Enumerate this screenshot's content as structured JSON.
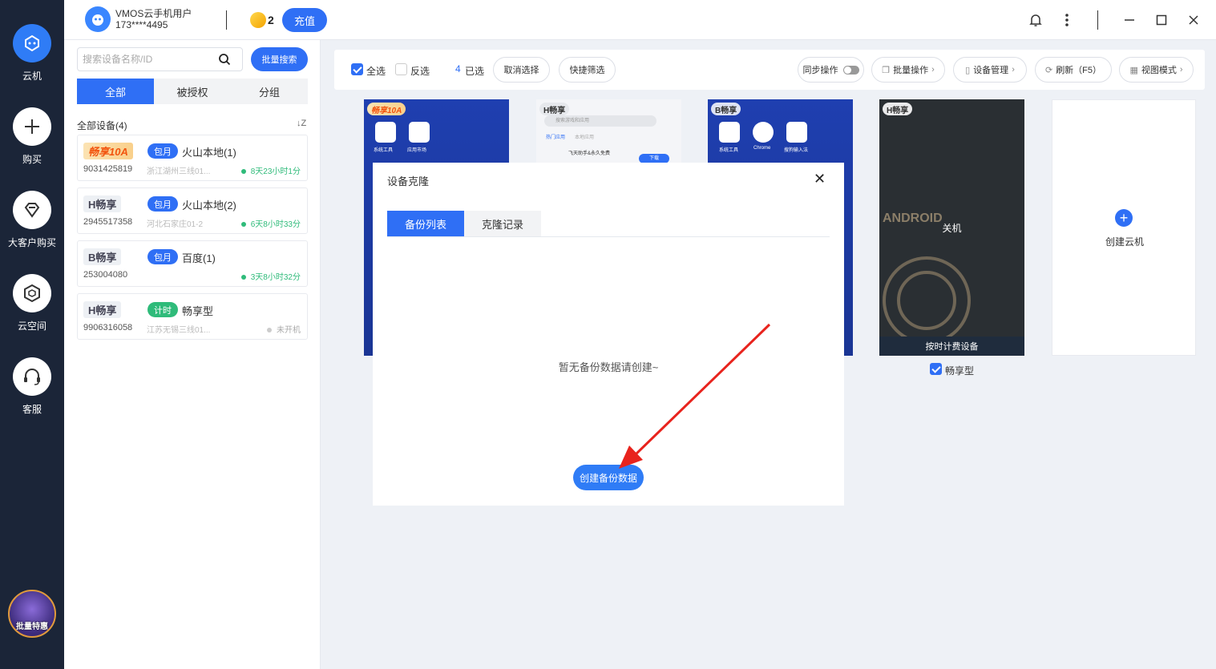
{
  "sidebar": {
    "items": [
      {
        "label": "云机",
        "icon": "cloud-phone-icon",
        "active": true
      },
      {
        "label": "购买",
        "icon": "plus-icon",
        "active": false
      },
      {
        "label": "大客户购买",
        "icon": "diamond-icon",
        "active": false
      },
      {
        "label": "云空间",
        "icon": "cube-icon",
        "active": false
      },
      {
        "label": "客服",
        "icon": "headset-icon",
        "active": false
      }
    ],
    "promo_label": "批量特惠"
  },
  "header": {
    "user_name": "VMOS云手机用户",
    "user_phone": "173****4495",
    "coin_count": "2",
    "recharge_label": "充值"
  },
  "device_panel": {
    "search_placeholder": "搜索设备名称/ID",
    "batch_search_label": "批量搜索",
    "tabs": [
      "全部",
      "被授权",
      "分组"
    ],
    "all_devices_label": "全部设备(4)",
    "devices": [
      {
        "tier": "畅享10A",
        "plan": "包月",
        "name": "火山本地(1)",
        "id": "9031425819",
        "location": "浙江湖州三线01...",
        "status": "8天23小时1分",
        "online": true
      },
      {
        "tier": "H畅享",
        "plan": "包月",
        "name": "火山本地(2)",
        "id": "2945517358",
        "location": "河北石家庄01-2",
        "status": "6天8小时33分",
        "online": true
      },
      {
        "tier": "B畅享",
        "plan": "包月",
        "name": "百度(1)",
        "id": "253004080",
        "location": "",
        "status": "3天8小时32分",
        "online": true
      },
      {
        "tier": "H畅享",
        "plan": "计时",
        "name": "畅享型",
        "id": "9906316058",
        "location": "江苏无锡三线01...",
        "status": "未开机",
        "online": false
      }
    ]
  },
  "toolbar": {
    "select_all": "全选",
    "invert": "反选",
    "selected_count": "4",
    "selected_label": "已选",
    "cancel_select": "取消选择",
    "quick_filter": "快捷筛选",
    "sync_op": "同步操作",
    "batch_op": "批量操作",
    "device_manage": "设备管理",
    "refresh": "刷新（F5）",
    "view_mode": "视图模式"
  },
  "device_grid": {
    "phones": [
      {
        "tier": "畅享10A",
        "apps": [
          "系统工具",
          "应用市场"
        ]
      },
      {
        "tier": "H畅享",
        "search_hint": "搜索游戏和应用",
        "tab_hot": "热门应用",
        "tab_local": "本地应用",
        "app_name": "飞天助手&永久免费",
        "download_label": "下载"
      },
      {
        "tier": "B畅享",
        "apps": [
          "系统工具",
          "Chrome",
          "搜狗输入法"
        ]
      },
      {
        "tier": "H畅享",
        "off_label": "关机",
        "android_word": "ANDROID",
        "hourly_label": "按时计费设备"
      }
    ],
    "checked_device_label": "畅享型",
    "create_label": "创建云机"
  },
  "modal": {
    "title": "设备克隆",
    "tabs": [
      "备份列表",
      "克隆记录"
    ],
    "empty_message": "暂无备份数据请创建~",
    "create_button": "创建备份数据"
  },
  "colors": {
    "accent": "#2f6ff5",
    "nav_bg": "#1b2538",
    "online": "#2fbb7a",
    "annotation_arrow": "#e8231d"
  }
}
